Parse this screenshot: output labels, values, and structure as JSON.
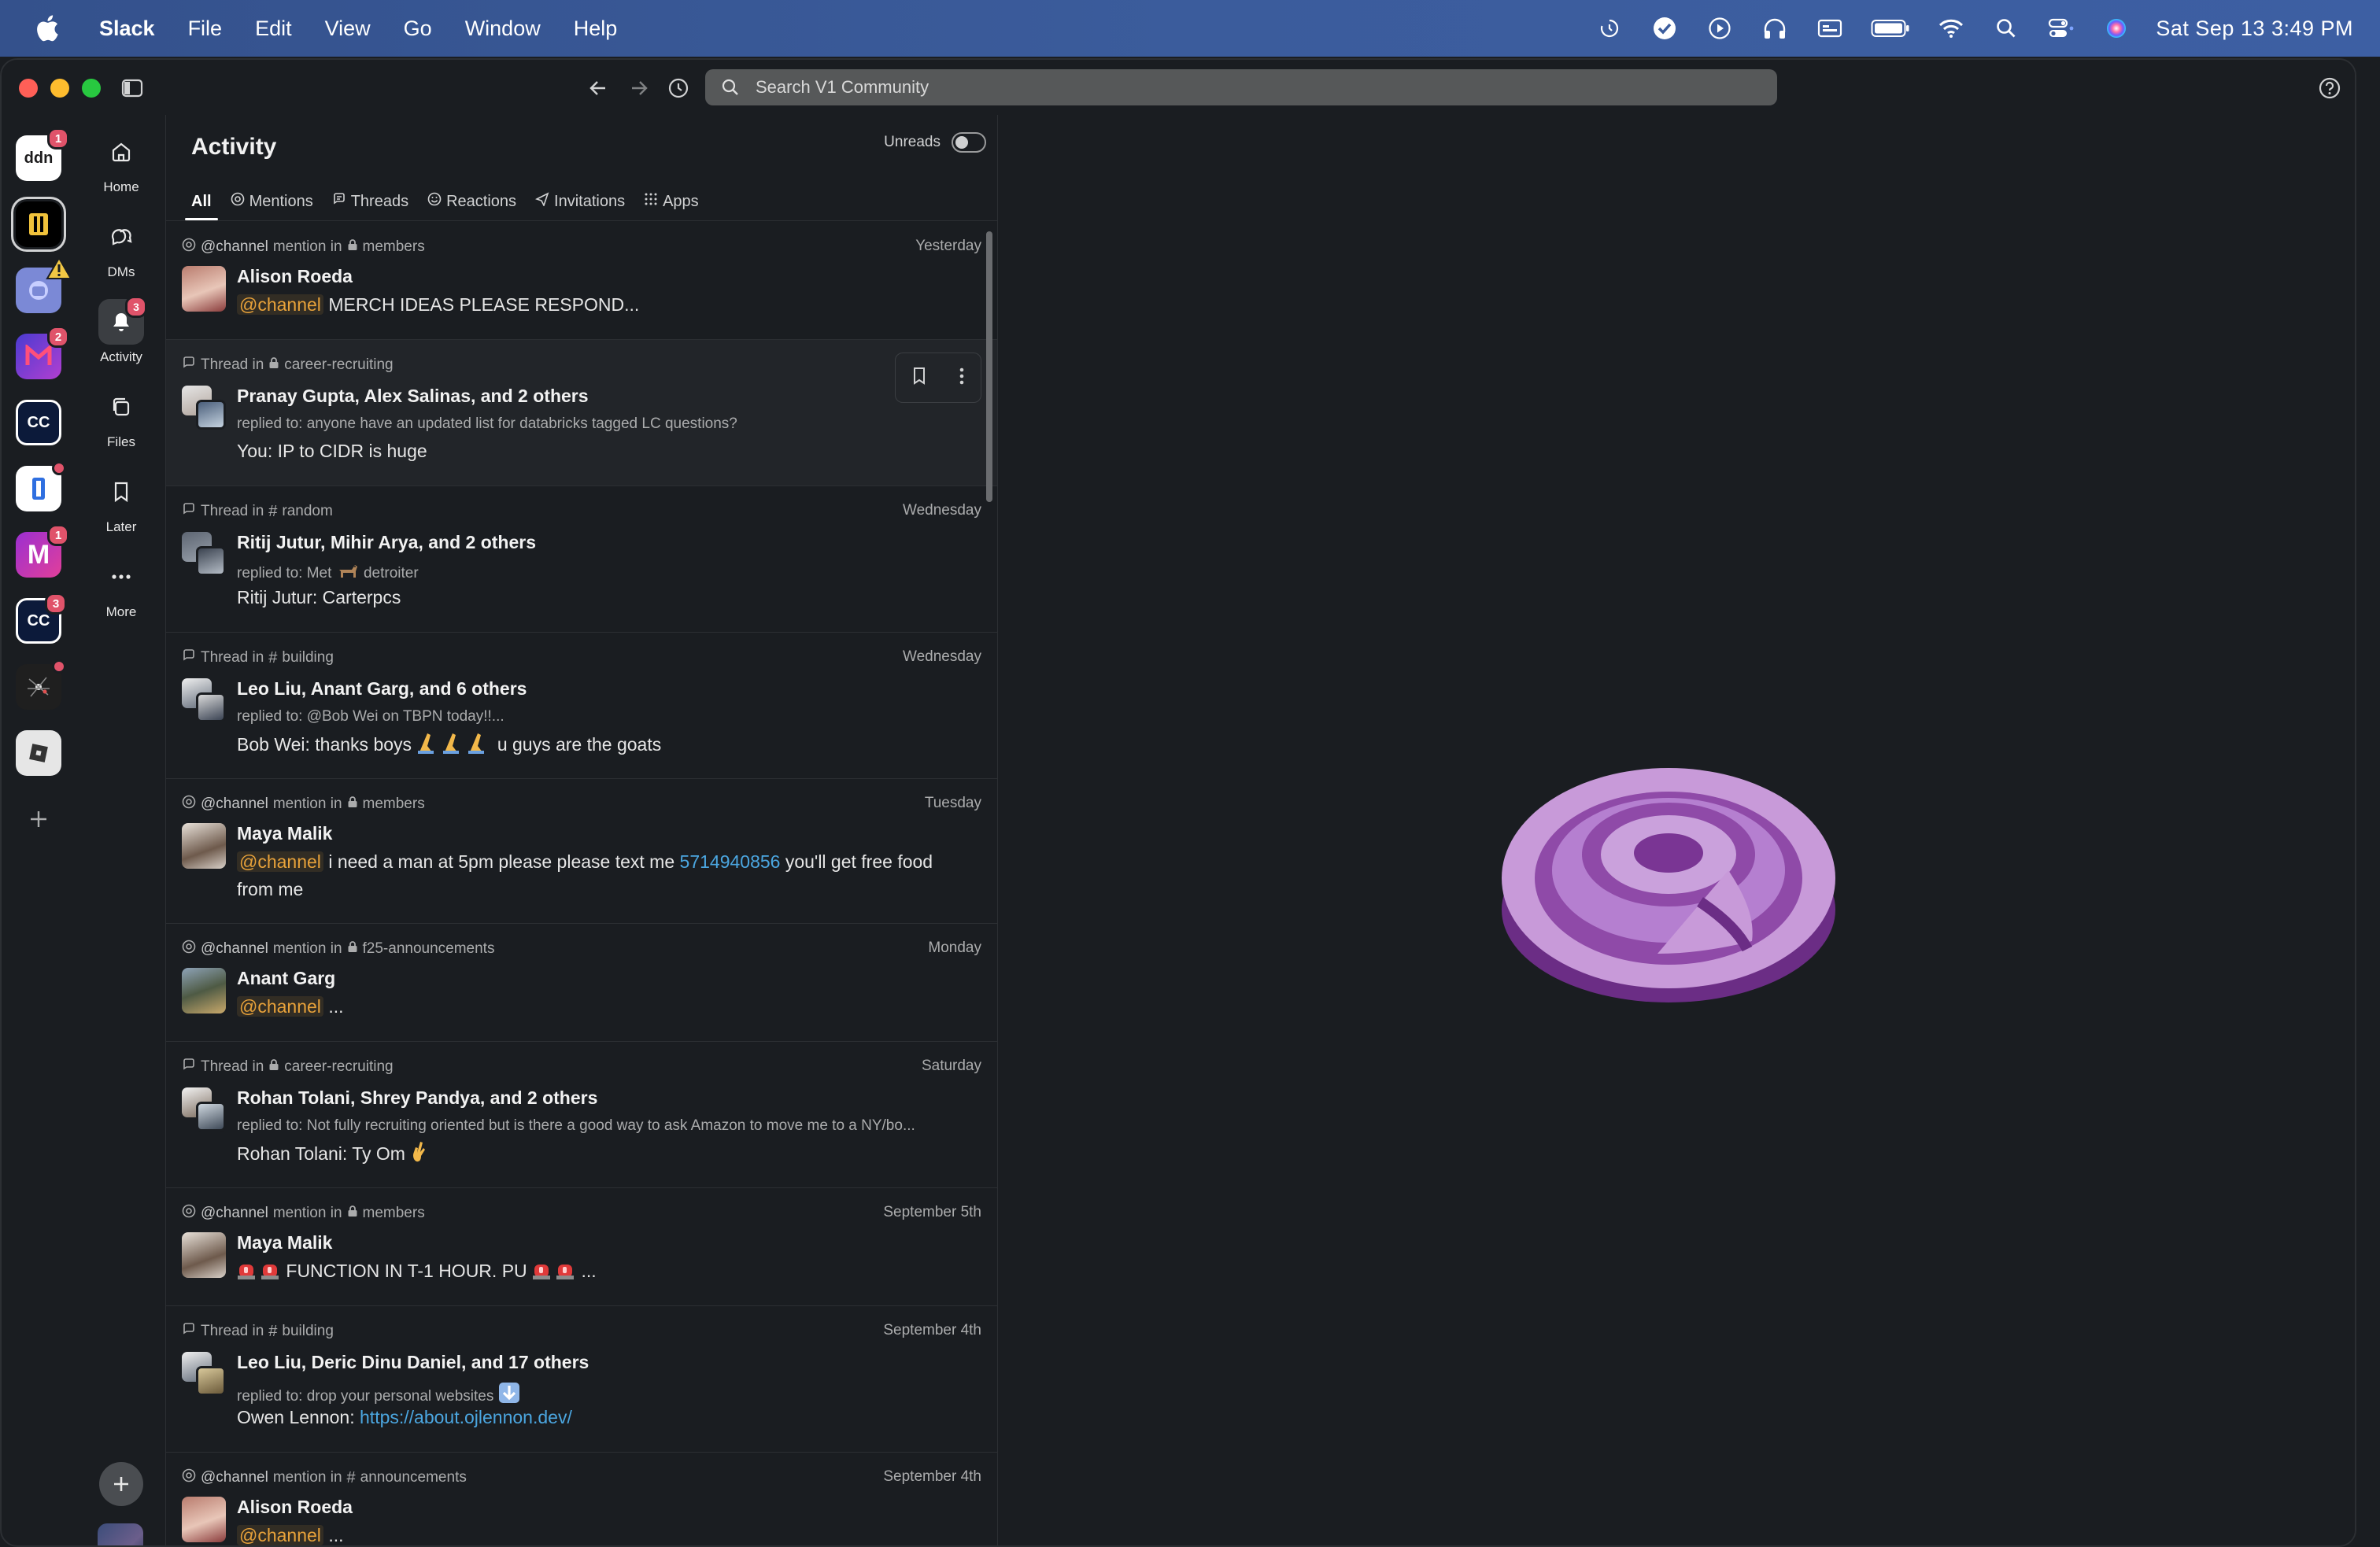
{
  "menubar": {
    "app_name": "Slack",
    "menus": [
      "File",
      "Edit",
      "View",
      "Go",
      "Window",
      "Help"
    ],
    "clock": "Sat Sep 13  3:49 PM",
    "status_icons": [
      "history-icon",
      "checkmark-app-icon",
      "play-icon",
      "headphones-icon",
      "display-icon",
      "battery-icon",
      "wifi-icon",
      "spotlight-search-icon",
      "control-center-icon",
      "siri-icon"
    ]
  },
  "toolbar": {
    "search_placeholder": "Search V1 Community"
  },
  "workspaces": [
    {
      "label": "ddn",
      "badge": "1",
      "color": "#ffffff",
      "text_color": "#1d1c1d"
    },
    {
      "label": "",
      "badge": "",
      "color": "#000000",
      "selected": true
    },
    {
      "label": "",
      "badge": "",
      "color": "#7b89d6",
      "warning": true
    },
    {
      "label": "",
      "badge": "2",
      "color": "#6b3fd1"
    },
    {
      "label": "CC",
      "badge": "",
      "color": "#ffffff"
    },
    {
      "label": "",
      "badge": "",
      "color": "#ffffff",
      "dot": true
    },
    {
      "label": "M",
      "badge": "1",
      "color": "#c23bb6"
    },
    {
      "label": "CC",
      "badge": "3",
      "color": "#ffffff"
    },
    {
      "label": "",
      "badge": "",
      "color": "#222222",
      "dot": true
    },
    {
      "label": "",
      "badge": "",
      "color": "#e6e6e6"
    }
  ],
  "sidebar": {
    "items": [
      {
        "label": "Home",
        "icon": "home-icon"
      },
      {
        "label": "DMs",
        "icon": "dms-icon"
      },
      {
        "label": "Activity",
        "icon": "bell-icon",
        "badge": "3",
        "active": true
      },
      {
        "label": "Files",
        "icon": "files-icon"
      },
      {
        "label": "Later",
        "icon": "bookmark-icon"
      },
      {
        "label": "More",
        "icon": "more-icon"
      }
    ]
  },
  "activity": {
    "title": "Activity",
    "unreads_label": "Unreads",
    "unreads_on": false,
    "tabs": [
      {
        "label": "All",
        "active": true
      },
      {
        "label": "Mentions",
        "icon": "at-icon"
      },
      {
        "label": "Threads",
        "icon": "thread-icon"
      },
      {
        "label": "Reactions",
        "icon": "smiley-icon"
      },
      {
        "label": "Invitations",
        "icon": "send-icon"
      },
      {
        "label": "Apps",
        "icon": "apps-grid-icon"
      }
    ],
    "items": [
      {
        "kind": "@channel",
        "kind_rest": "mention in",
        "channel_type": "private",
        "channel": "members",
        "time": "Yesterday",
        "names": "Alison Roeda",
        "mention": "@channel",
        "message": "MERCH IDEAS PLEASE RESPOND..."
      },
      {
        "kind": "Thread in",
        "channel_type": "private",
        "channel": "career-recruiting",
        "time": "",
        "names": "Pranay Gupta, Alex Salinas, and 2 others",
        "replied": "replied to: anyone have an updated list for databricks tagged LC questions?",
        "message": "You: IP to CIDR is huge"
      },
      {
        "kind": "Thread in",
        "channel_type": "public",
        "channel": "random",
        "time": "Wednesday",
        "names": "Ritij Jutur, Mihir Arya, and 2 others",
        "replied_before": "replied to: Met",
        "replied_after": "detroiter",
        "message": "Ritij Jutur: Carterpcs"
      },
      {
        "kind": "Thread in",
        "channel_type": "public",
        "channel": "building",
        "time": "Wednesday",
        "names": "Leo Liu, Anant Garg, and 6 others",
        "replied": "replied to: @Bob Wei on TBPN today!!...",
        "message_before": "Bob Wei: thanks boys",
        "message_after": "u guys are the goats"
      },
      {
        "kind": "@channel",
        "kind_rest": "mention in",
        "channel_type": "private",
        "channel": "members",
        "time": "Tuesday",
        "names": "Maya Malik",
        "mention": "@channel",
        "message_before": "i need a man at 5pm please please text me",
        "link": "5714940856",
        "message_after": "you'll get free food",
        "message_line2": "from me"
      },
      {
        "kind": "@channel",
        "kind_rest": "mention in",
        "channel_type": "private",
        "channel": "f25-announcements",
        "time": "Monday",
        "names": "Anant Garg",
        "mention": "@channel",
        "message": "..."
      },
      {
        "kind": "Thread in",
        "channel_type": "private",
        "channel": "career-recruiting",
        "time": "Saturday",
        "names": "Rohan Tolani, Shrey Pandya, and 2 others",
        "replied": "replied to: Not fully recruiting oriented but is there a good way to ask Amazon to move me to a NY/bo...",
        "message": "Rohan Tolani: Ty Om"
      },
      {
        "kind": "@channel",
        "kind_rest": "mention in",
        "channel_type": "private",
        "channel": "members",
        "time": "September 5th",
        "names": "Maya Malik",
        "message": "FUNCTION IN T-1 HOUR. PU",
        "message_after": "..."
      },
      {
        "kind": "Thread in",
        "channel_type": "public",
        "channel": "building",
        "time": "September 4th",
        "names": "Leo Liu, Deric Dinu Daniel, and 17 others",
        "replied": "replied to: drop your personal websites",
        "message_before": "Owen Lennon:",
        "link": "https://about.ojlennon.dev/"
      },
      {
        "kind": "@channel",
        "kind_rest": "mention in",
        "channel_type": "public",
        "channel": "announcements",
        "time": "September 4th",
        "names": "Alison Roeda",
        "mention": "@channel",
        "message": "..."
      }
    ]
  },
  "colors": {
    "background": "#1a1d21",
    "mention": "#e8a23a",
    "link": "#4ba6e0",
    "badge": "#e0536a",
    "illustration": "#b57fd0"
  }
}
